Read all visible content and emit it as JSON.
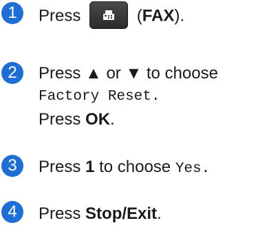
{
  "steps": [
    {
      "number": "1",
      "press": "Press",
      "fax_label_open": "(",
      "fax_label": "FAX",
      "fax_label_close": ").",
      "icon": "fax-icon"
    },
    {
      "number": "2",
      "line1": "Press ▲ or ▼ to choose",
      "line2": "Factory Reset.",
      "line3_press": "Press",
      "line3_key": "OK",
      "line3_end": "."
    },
    {
      "number": "3",
      "press": "Press",
      "key": "1",
      "middle": "to choose",
      "value": "Yes."
    },
    {
      "number": "4",
      "press": "Press",
      "key": "Stop/Exit",
      "end": "."
    }
  ],
  "colors": {
    "badge": "#1d6fd6",
    "button": "#3a3a3a"
  }
}
